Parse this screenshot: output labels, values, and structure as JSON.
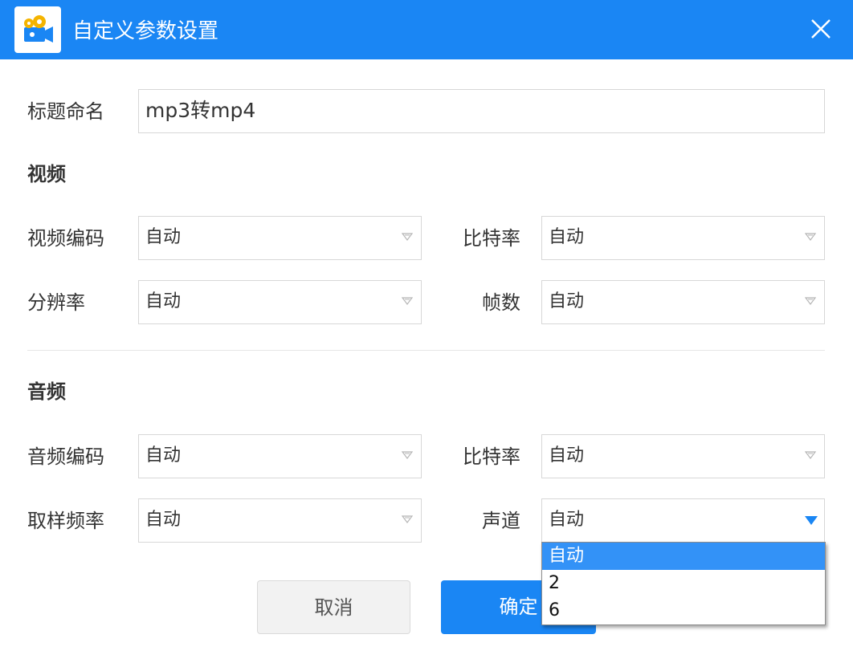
{
  "dialog": {
    "title": "自定义参数设置",
    "accent_color": "#1a86f4",
    "icon": "film-camera-icon",
    "close_icon": "close-icon"
  },
  "title_field": {
    "label": "标题命名",
    "value": "mp3转mp4"
  },
  "video": {
    "heading": "视频",
    "codec": {
      "label": "视频编码",
      "value": "自动"
    },
    "bitrate": {
      "label": "比特率",
      "value": "自动"
    },
    "resolution": {
      "label": "分辨率",
      "value": "自动"
    },
    "framerate": {
      "label": "帧数",
      "value": "自动"
    }
  },
  "audio": {
    "heading": "音频",
    "codec": {
      "label": "音频编码",
      "value": "自动"
    },
    "bitrate": {
      "label": "比特率",
      "value": "自动"
    },
    "samplerate": {
      "label": "取样频率",
      "value": "自动"
    },
    "channels": {
      "label": "声道",
      "value": "自动",
      "expanded": true,
      "options": [
        "自动",
        "2",
        "6"
      ],
      "selected_option": "自动"
    }
  },
  "buttons": {
    "cancel": "取消",
    "ok": "确定"
  }
}
